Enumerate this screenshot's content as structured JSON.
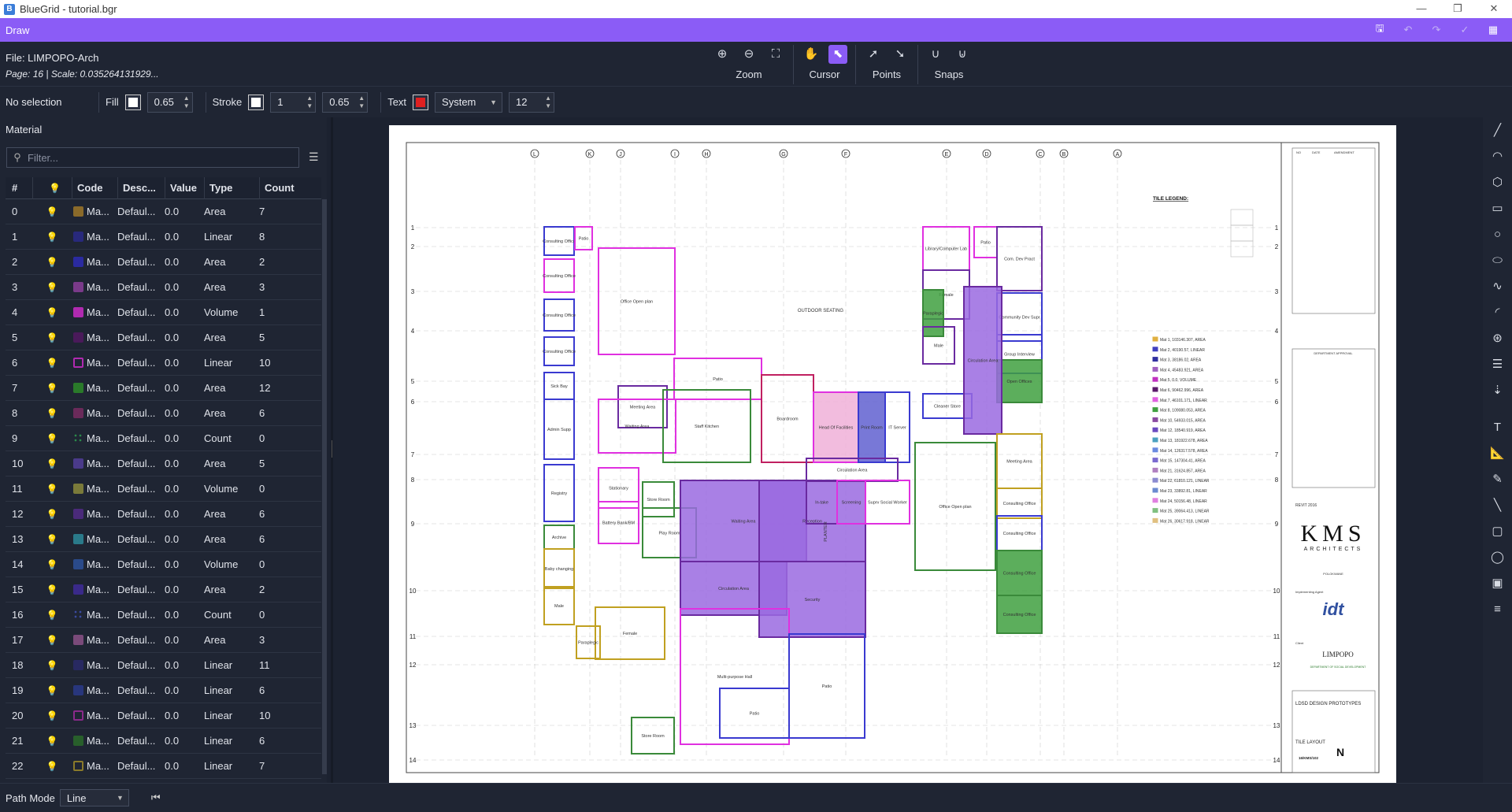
{
  "window": {
    "title": "BlueGrid - tutorial.bgr",
    "app_icon": "B",
    "minimize": "—",
    "maximize": "❐",
    "close": "✕"
  },
  "ribbon": {
    "title": "Draw",
    "icons": [
      "save-icon",
      "undo-icon",
      "redo-icon",
      "check-icon",
      "grid-icon"
    ]
  },
  "file": {
    "name": "File: LIMPOPO-Arch",
    "page": "Page: 16 | Scale: 0.035264131929..."
  },
  "tool_groups": [
    {
      "label": "Zoom",
      "icons": [
        "zoom-in-icon",
        "zoom-out-icon",
        "zoom-fit-icon"
      ]
    },
    {
      "label": "Cursor",
      "icons": [
        "hand-icon",
        "select-cursor-icon"
      ]
    },
    {
      "label": "Points",
      "icons": [
        "point-add-icon",
        "point-remove-icon"
      ]
    },
    {
      "label": "Snaps",
      "icons": [
        "snap-icon",
        "snap-off-icon"
      ]
    }
  ],
  "properties": {
    "selection": "No selection",
    "fill_label": "Fill",
    "fill_color": "#ffffff",
    "fill_opacity": "0.65",
    "stroke_label": "Stroke",
    "stroke_color": "#ffffff",
    "stroke_width": "1",
    "stroke_opacity": "0.65",
    "text_label": "Text",
    "text_color": "#e02020",
    "font": "System",
    "font_size": "12"
  },
  "material_panel": {
    "title": "Material",
    "filter_placeholder": "Filter...",
    "columns": [
      "#",
      "",
      "Code",
      "Desc...",
      "Value",
      "Type",
      "Count"
    ],
    "rows": [
      {
        "id": "0",
        "code": "Ma...",
        "desc": "Defaul...",
        "value": "0.0",
        "type": "Area",
        "count": "7",
        "color": "#8a6a2a",
        "shape": "fill"
      },
      {
        "id": "1",
        "code": "Ma...",
        "desc": "Defaul...",
        "value": "0.0",
        "type": "Linear",
        "count": "8",
        "color": "#2a2a8a",
        "shape": "line"
      },
      {
        "id": "2",
        "code": "Ma...",
        "desc": "Defaul...",
        "value": "0.0",
        "type": "Area",
        "count": "2",
        "color": "#2a2aa0",
        "shape": "fill"
      },
      {
        "id": "3",
        "code": "Ma...",
        "desc": "Defaul...",
        "value": "0.0",
        "type": "Area",
        "count": "3",
        "color": "#7a3a8a",
        "shape": "fill"
      },
      {
        "id": "4",
        "code": "Ma...",
        "desc": "Defaul...",
        "value": "0.0",
        "type": "Volume",
        "count": "1",
        "color": "#b02ab0",
        "shape": "fill"
      },
      {
        "id": "5",
        "code": "Ma...",
        "desc": "Defaul...",
        "value": "0.0",
        "type": "Area",
        "count": "5",
        "color": "#4a1a5a",
        "shape": "fill"
      },
      {
        "id": "6",
        "code": "Ma...",
        "desc": "Defaul...",
        "value": "0.0",
        "type": "Linear",
        "count": "10",
        "color": "#b02ab0",
        "shape": "outline"
      },
      {
        "id": "7",
        "code": "Ma...",
        "desc": "Defaul...",
        "value": "0.0",
        "type": "Area",
        "count": "12",
        "color": "#2a7a2a",
        "shape": "fill"
      },
      {
        "id": "8",
        "code": "Ma...",
        "desc": "Defaul...",
        "value": "0.0",
        "type": "Area",
        "count": "6",
        "color": "#6a2a5a",
        "shape": "fill"
      },
      {
        "id": "9",
        "code": "Ma...",
        "desc": "Defaul...",
        "value": "0.0",
        "type": "Count",
        "count": "0",
        "color": "#2a8a4a",
        "shape": "dots"
      },
      {
        "id": "10",
        "code": "Ma...",
        "desc": "Defaul...",
        "value": "0.0",
        "type": "Area",
        "count": "5",
        "color": "#4a3a8a",
        "shape": "fill"
      },
      {
        "id": "11",
        "code": "Ma...",
        "desc": "Defaul...",
        "value": "0.0",
        "type": "Volume",
        "count": "0",
        "color": "#7a7a3a",
        "shape": "fill"
      },
      {
        "id": "12",
        "code": "Ma...",
        "desc": "Defaul...",
        "value": "0.0",
        "type": "Area",
        "count": "6",
        "color": "#4a2a7a",
        "shape": "fill"
      },
      {
        "id": "13",
        "code": "Ma...",
        "desc": "Defaul...",
        "value": "0.0",
        "type": "Area",
        "count": "6",
        "color": "#2a7a8a",
        "shape": "fill"
      },
      {
        "id": "14",
        "code": "Ma...",
        "desc": "Defaul...",
        "value": "0.0",
        "type": "Volume",
        "count": "0",
        "color": "#2a4a8a",
        "shape": "fill"
      },
      {
        "id": "15",
        "code": "Ma...",
        "desc": "Defaul...",
        "value": "0.0",
        "type": "Area",
        "count": "2",
        "color": "#3a2a8a",
        "shape": "fill"
      },
      {
        "id": "16",
        "code": "Ma...",
        "desc": "Defaul...",
        "value": "0.0",
        "type": "Count",
        "count": "0",
        "color": "#3a4aa0",
        "shape": "dots"
      },
      {
        "id": "17",
        "code": "Ma...",
        "desc": "Defaul...",
        "value": "0.0",
        "type": "Area",
        "count": "3",
        "color": "#7a4a7a",
        "shape": "fill"
      },
      {
        "id": "18",
        "code": "Ma...",
        "desc": "Defaul...",
        "value": "0.0",
        "type": "Linear",
        "count": "11",
        "color": "#2a2a6a",
        "shape": "line"
      },
      {
        "id": "19",
        "code": "Ma...",
        "desc": "Defaul...",
        "value": "0.0",
        "type": "Linear",
        "count": "6",
        "color": "#2a3a8a",
        "shape": "line"
      },
      {
        "id": "20",
        "code": "Ma...",
        "desc": "Defaul...",
        "value": "0.0",
        "type": "Linear",
        "count": "10",
        "color": "#8a2a8a",
        "shape": "outline"
      },
      {
        "id": "21",
        "code": "Ma...",
        "desc": "Defaul...",
        "value": "0.0",
        "type": "Linear",
        "count": "6",
        "color": "#2a6a2a",
        "shape": "line"
      },
      {
        "id": "22",
        "code": "Ma...",
        "desc": "Defaul...",
        "value": "0.0",
        "type": "Linear",
        "count": "7",
        "color": "#8a7a2a",
        "shape": "outline"
      }
    ]
  },
  "drawing": {
    "grid_top": [
      "L",
      "K",
      "J",
      "I",
      "H",
      "G",
      "F",
      "E",
      "D",
      "C",
      "B",
      "A"
    ],
    "grid_side": [
      "1",
      "2",
      "3",
      "4",
      "5",
      "6",
      "7",
      "8",
      "9",
      "10",
      "11",
      "12",
      "13",
      "14"
    ],
    "rooms": [
      {
        "label": "Consulting Office",
        "fill": "none",
        "stroke": "#3a3ad0"
      },
      {
        "label": "Consulting Office",
        "fill": "none",
        "stroke": "#e030e0"
      },
      {
        "label": "Consulting Office",
        "fill": "none",
        "stroke": "#3a3ad0"
      },
      {
        "label": "Consulting Office",
        "fill": "none",
        "stroke": "#3a3ad0"
      },
      {
        "label": "Patio",
        "fill": "none",
        "stroke": "#e030e0"
      },
      {
        "label": "Office Open plan",
        "fill": "none",
        "stroke": "#e030e0"
      },
      {
        "label": "Sick Bay",
        "fill": "none",
        "stroke": "#3a3ad0"
      },
      {
        "label": "Admin Supp",
        "fill": "none",
        "stroke": "#3a3ad0"
      },
      {
        "label": "Meeting Area",
        "fill": "none",
        "stroke": "#6a2aa0"
      },
      {
        "label": "Waiting Area",
        "fill": "none",
        "stroke": "#e030e0"
      },
      {
        "label": "Patio",
        "fill": "none",
        "stroke": "#e030e0"
      },
      {
        "label": "Staff Kitchen",
        "fill": "none",
        "stroke": "#3a8a3a"
      },
      {
        "label": "Boardroom",
        "fill": "none",
        "stroke": "#c02060"
      },
      {
        "label": "Head Of Facilities",
        "fill": "#f0b0d8",
        "stroke": "#e030e0"
      },
      {
        "label": "Print Room",
        "fill": "#6060d0",
        "stroke": "#3a3ad0"
      },
      {
        "label": "IT Server",
        "fill": "none",
        "stroke": "#3a3ad0"
      },
      {
        "label": "Registry",
        "fill": "none",
        "stroke": "#3a3ad0"
      },
      {
        "label": "Stationary",
        "fill": "none",
        "stroke": "#e030e0"
      },
      {
        "label": "Store Room",
        "fill": "none",
        "stroke": "#3a8a3a"
      },
      {
        "label": "Archive",
        "fill": "none",
        "stroke": "#3a8a3a"
      },
      {
        "label": "Battery Bank/BM",
        "fill": "none",
        "stroke": "#e030e0"
      },
      {
        "label": "Play Room",
        "fill": "none",
        "stroke": "#3a8a3a"
      },
      {
        "label": "Waiting Area",
        "fill": "#9a6ae0",
        "stroke": "#6a2aa0"
      },
      {
        "label": "Reception",
        "fill": "#9a6ae0",
        "stroke": "#6a2aa0"
      },
      {
        "label": "Circulation Area",
        "fill": "#9a6ae0",
        "stroke": "#6a2aa0"
      },
      {
        "label": "Security",
        "fill": "#9a6ae0",
        "stroke": "#6a2aa0"
      },
      {
        "label": "Baby changing",
        "fill": "none",
        "stroke": "#c0a020"
      },
      {
        "label": "Male",
        "fill": "none",
        "stroke": "#c0a020"
      },
      {
        "label": "Female",
        "fill": "none",
        "stroke": "#c0a020"
      },
      {
        "label": "Paraplegic",
        "fill": "none",
        "stroke": "#c0a020"
      },
      {
        "label": "Multi-purpose Hall",
        "fill": "none",
        "stroke": "#e030e0"
      },
      {
        "label": "Patio",
        "fill": "none",
        "stroke": "#3a3ad0"
      },
      {
        "label": "Patio",
        "fill": "none",
        "stroke": "#3a3ad0"
      },
      {
        "label": "Store Room",
        "fill": "none",
        "stroke": "#3a8a3a"
      },
      {
        "label": "Circulation Area",
        "fill": "none",
        "stroke": "#6a2aa0"
      },
      {
        "label": "In-take",
        "fill": "none",
        "stroke": "#6a2aa0"
      },
      {
        "label": "Screening",
        "fill": "none",
        "stroke": "#e030e0"
      },
      {
        "label": "Suprv Social Worker",
        "fill": "none",
        "stroke": "#e030e0"
      },
      {
        "label": "Library/Computer Lab",
        "fill": "none",
        "stroke": "#e030e0"
      },
      {
        "label": "Patio",
        "fill": "none",
        "stroke": "#e030e0"
      },
      {
        "label": "Com. Dev Pract",
        "fill": "none",
        "stroke": "#6a2aa0"
      },
      {
        "label": "Female",
        "fill": "none",
        "stroke": "#6a2aa0"
      },
      {
        "label": "Paraplegic",
        "fill": "#40a040",
        "stroke": "#3a8a3a"
      },
      {
        "label": "Male",
        "fill": "none",
        "stroke": "#6a2aa0"
      },
      {
        "label": "Community Dev Supr",
        "fill": "none",
        "stroke": "#3a3ad0"
      },
      {
        "label": "Group Interview",
        "fill": "none",
        "stroke": "#3a3ad0"
      },
      {
        "label": "Cleaner Store",
        "fill": "none",
        "stroke": "#3a3ad0"
      },
      {
        "label": "Open Offices",
        "fill": "#40a040",
        "stroke": "#3a8a3a"
      },
      {
        "label": "Circulation Area",
        "fill": "#9a6ae0",
        "stroke": "#6a2aa0"
      },
      {
        "label": "Meeting Area",
        "fill": "none",
        "stroke": "#c0a020"
      },
      {
        "label": "Consulting Office",
        "fill": "none",
        "stroke": "#c0a020"
      },
      {
        "label": "Office Open plan",
        "fill": "none",
        "stroke": "#3a8a3a"
      },
      {
        "label": "Consulting Office",
        "fill": "none",
        "stroke": "#3a3ad0"
      },
      {
        "label": "Consulting Office",
        "fill": "#40a040",
        "stroke": "#3a8a3a"
      },
      {
        "label": "Consulting Office",
        "fill": "#40a040",
        "stroke": "#3a8a3a"
      }
    ],
    "labels": [
      "OUTDOOR SEATING",
      "PLANTER",
      "N"
    ],
    "legend_title": "TILE LEGEND:",
    "legend_items": [
      {
        "label": "Mat 1, 103146.307, AREA",
        "color": "#e0b040"
      },
      {
        "label": "Mat 2, 40190.57, LINEAR",
        "color": "#4040c0"
      },
      {
        "label": "Mat 3, 38186.02, AREA",
        "color": "#3030a0"
      },
      {
        "label": "Mat 4, 45483.921, AREA",
        "color": "#a060c0"
      },
      {
        "label": "Mat 5, 0.0, VOLUME",
        "color": "#c030c0"
      },
      {
        "label": "Mat 6, 90462.996, AREA",
        "color": "#5a1a6a"
      },
      {
        "label": "Mat 7, 46101.171, LINEAR",
        "color": "#e060e0"
      },
      {
        "label": "Mat 8, 109080.053, AREA",
        "color": "#40a040"
      },
      {
        "label": "Mat 10, 54933.015, AREA",
        "color": "#8a4aa0"
      },
      {
        "label": "Mat 12, 18540.919, AREA",
        "color": "#6a4ac0"
      },
      {
        "label": "Mat 13, 181922.678, AREA",
        "color": "#4aa0c0"
      },
      {
        "label": "Mat 14, 126317.578, AREA",
        "color": "#6a8ae0"
      },
      {
        "label": "Mat 15, 147304.41, AREA",
        "color": "#7a6ad0"
      },
      {
        "label": "Mat 21, 31624.857, AREA",
        "color": "#b080c0"
      },
      {
        "label": "Mat 22, 61810.121, LINEAR",
        "color": "#8a8ad0"
      },
      {
        "label": "Mat 23, 33892.81, LINEAR",
        "color": "#6a8ad0"
      },
      {
        "label": "Mat 24, 50156.48, LINEAR",
        "color": "#e080e0"
      },
      {
        "label": "Mat 25, 39064.413, LINEAR",
        "color": "#80c080"
      },
      {
        "label": "Mat 26, 30617.918, LINEAR",
        "color": "#e0c080"
      }
    ],
    "title_block": {
      "firm": "KMS",
      "firm_sub": "ARCHITECTS",
      "city": "POLOKWANE",
      "agent_label": "Implementing Agent",
      "agent": "idt",
      "client_label": "Client",
      "client": "LIMPOPO",
      "client_sub": "DEPARTMENT OF SOCIAL DEVELOPMENT",
      "project": "LDSD DESIGN PROTOTYPES",
      "drawing_title": "TILE LAYOUT",
      "drawing_no": "16/KMS/102",
      "software": "REVIT 2016",
      "approval": "DEPARTMENT APPROVAL",
      "rev_headers": [
        "NO",
        "DATE",
        "AMENDMENT"
      ]
    }
  },
  "right_tools": [
    "line-icon",
    "arc-icon",
    "hexagon-icon",
    "rectangle-icon",
    "circle-icon",
    "ellipse-icon",
    "curve-icon",
    "arc2-icon",
    "dimension-icon",
    "text-stack-icon",
    "measure-icon",
    "text-icon",
    "ruler-icon",
    "pencil-icon",
    "line2-icon",
    "shape-icon",
    "circle2-icon",
    "stamp-icon",
    "list-icon"
  ],
  "status": {
    "path_mode_label": "Path Mode",
    "path_mode_value": "Line",
    "collapse_icon": "⏮"
  }
}
